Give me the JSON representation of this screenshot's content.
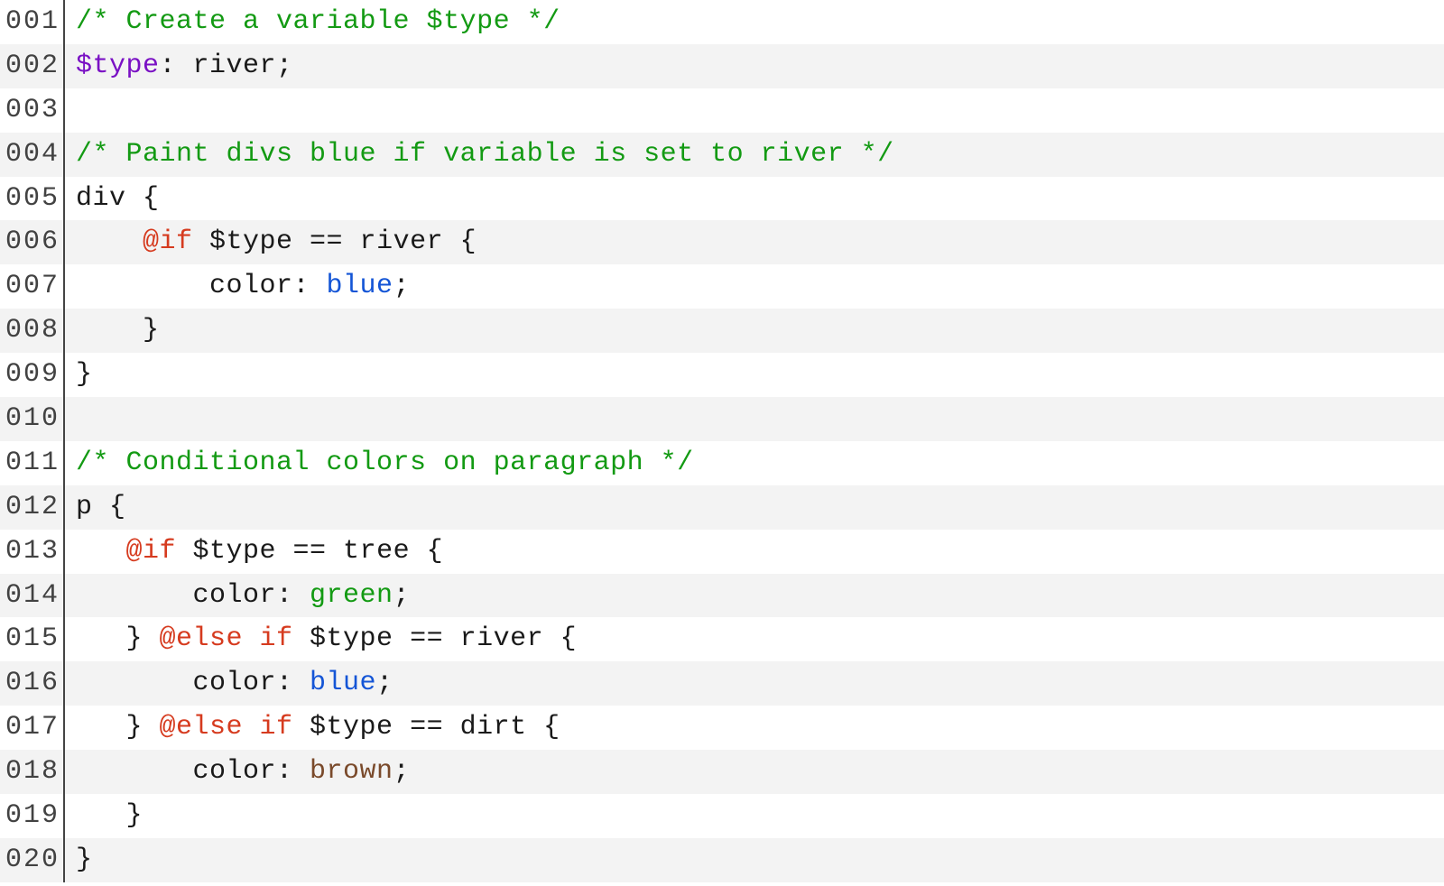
{
  "colors": {
    "default": "#1a1a1a",
    "comment": "#139a13",
    "variable": "#7a11c4",
    "keyword": "#d63b1f",
    "value_blue": "#1455d6",
    "value_green": "#139a13",
    "value_brown": "#7a4a2b",
    "gutter_border": "#444444",
    "row_even_bg": "#f3f3f3",
    "row_odd_bg": "#ffffff"
  },
  "lines": [
    {
      "n": "001",
      "tokens": [
        {
          "t": "/* Create a variable $type */",
          "c": "comment"
        }
      ]
    },
    {
      "n": "002",
      "tokens": [
        {
          "t": "$type",
          "c": "variable"
        },
        {
          "t": ": river;",
          "c": "default"
        }
      ]
    },
    {
      "n": "003",
      "tokens": [
        {
          "t": "",
          "c": "default"
        }
      ]
    },
    {
      "n": "004",
      "tokens": [
        {
          "t": "/* Paint divs blue if variable is set to river */",
          "c": "comment"
        }
      ]
    },
    {
      "n": "005",
      "tokens": [
        {
          "t": "div {",
          "c": "default"
        }
      ]
    },
    {
      "n": "006",
      "tokens": [
        {
          "t": "    ",
          "c": "default"
        },
        {
          "t": "@if",
          "c": "keyword"
        },
        {
          "t": " $type == river {",
          "c": "default"
        }
      ]
    },
    {
      "n": "007",
      "tokens": [
        {
          "t": "        color: ",
          "c": "default"
        },
        {
          "t": "blue",
          "c": "value-blue"
        },
        {
          "t": ";",
          "c": "default"
        }
      ]
    },
    {
      "n": "008",
      "tokens": [
        {
          "t": "    }",
          "c": "default"
        }
      ]
    },
    {
      "n": "009",
      "tokens": [
        {
          "t": "}",
          "c": "default"
        }
      ]
    },
    {
      "n": "010",
      "tokens": [
        {
          "t": "",
          "c": "default"
        }
      ]
    },
    {
      "n": "011",
      "tokens": [
        {
          "t": "/* Conditional colors on paragraph */",
          "c": "comment"
        }
      ]
    },
    {
      "n": "012",
      "tokens": [
        {
          "t": "p {",
          "c": "default"
        }
      ]
    },
    {
      "n": "013",
      "tokens": [
        {
          "t": "   ",
          "c": "default"
        },
        {
          "t": "@if",
          "c": "keyword"
        },
        {
          "t": " $type == tree {",
          "c": "default"
        }
      ]
    },
    {
      "n": "014",
      "tokens": [
        {
          "t": "       color: ",
          "c": "default"
        },
        {
          "t": "green",
          "c": "value-green"
        },
        {
          "t": ";",
          "c": "default"
        }
      ]
    },
    {
      "n": "015",
      "tokens": [
        {
          "t": "   } ",
          "c": "default"
        },
        {
          "t": "@else if",
          "c": "keyword"
        },
        {
          "t": " $type == river {",
          "c": "default"
        }
      ]
    },
    {
      "n": "016",
      "tokens": [
        {
          "t": "       color: ",
          "c": "default"
        },
        {
          "t": "blue",
          "c": "value-blue"
        },
        {
          "t": ";",
          "c": "default"
        }
      ]
    },
    {
      "n": "017",
      "tokens": [
        {
          "t": "   } ",
          "c": "default"
        },
        {
          "t": "@else if",
          "c": "keyword"
        },
        {
          "t": " $type == dirt {",
          "c": "default"
        }
      ]
    },
    {
      "n": "018",
      "tokens": [
        {
          "t": "       color: ",
          "c": "default"
        },
        {
          "t": "brown",
          "c": "value-brown"
        },
        {
          "t": ";",
          "c": "default"
        }
      ]
    },
    {
      "n": "019",
      "tokens": [
        {
          "t": "   }",
          "c": "default"
        }
      ]
    },
    {
      "n": "020",
      "tokens": [
        {
          "t": "}",
          "c": "default"
        }
      ]
    }
  ]
}
